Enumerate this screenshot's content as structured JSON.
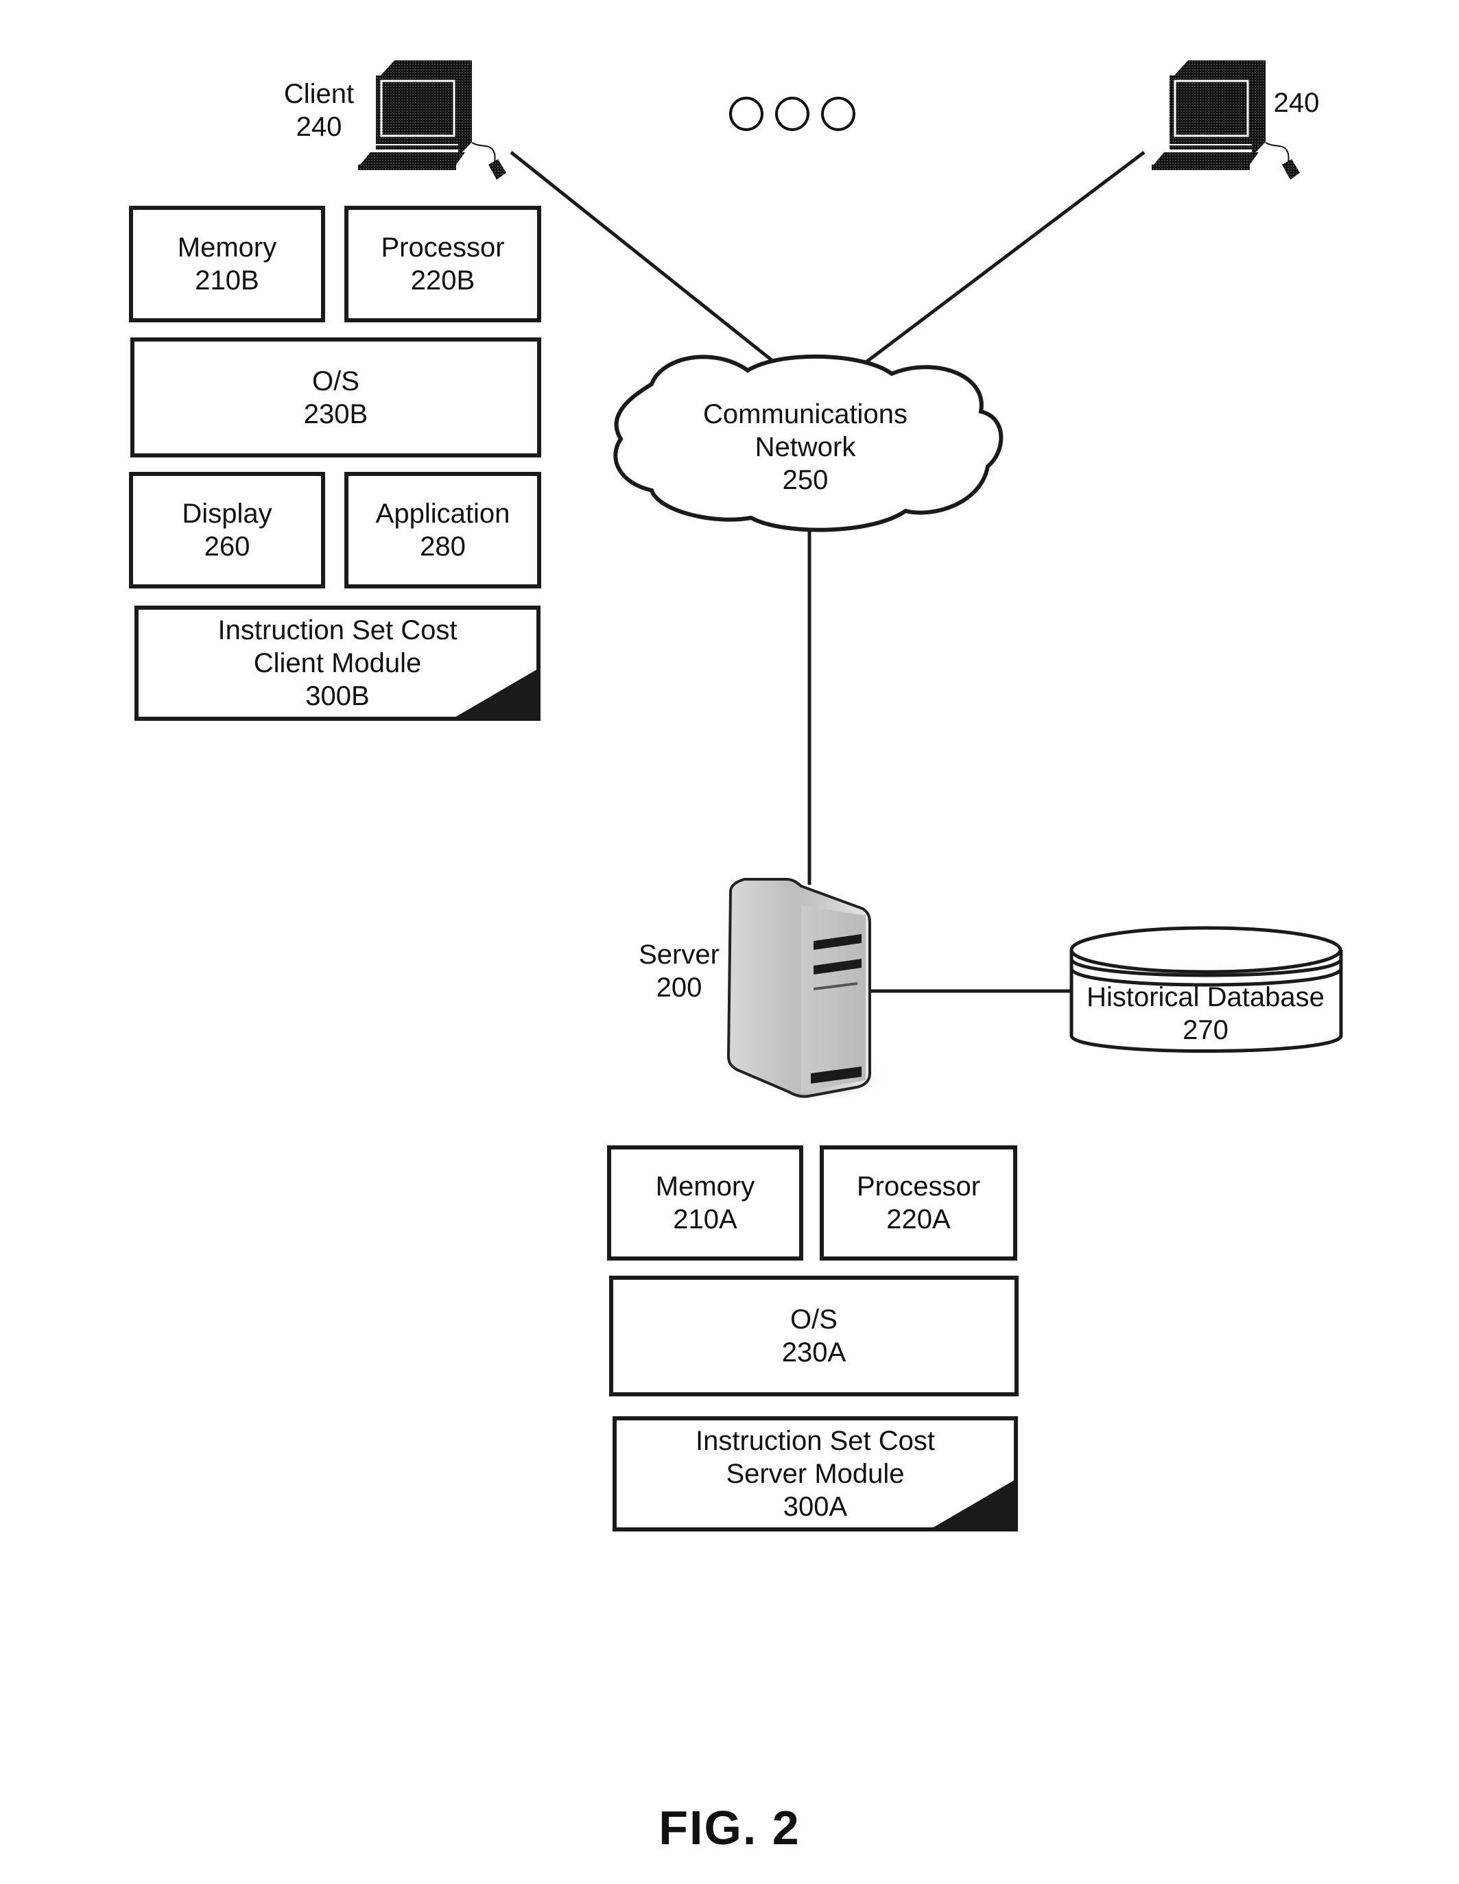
{
  "figure": {
    "caption": "FIG. 2"
  },
  "clients": [
    {
      "label": "Client",
      "ref": "240",
      "icon": "desktop-computer-icon"
    },
    {
      "label": "",
      "ref": "240",
      "icon": "desktop-computer-icon"
    }
  ],
  "ellipsis": {
    "icon": "ellipsis-circles-icon",
    "count": 3
  },
  "client_components": {
    "memory": {
      "name": "Memory",
      "ref": "210B"
    },
    "processor": {
      "name": "Processor",
      "ref": "220B"
    },
    "os": {
      "name": "O/S",
      "ref": "230B"
    },
    "display": {
      "name": "Display",
      "ref": "260"
    },
    "application": {
      "name": "Application",
      "ref": "280"
    },
    "module": {
      "line1": "Instruction Set Cost",
      "line2": "Client Module",
      "ref": "300B"
    }
  },
  "network": {
    "line1": "Communications",
    "line2": "Network",
    "ref": "250",
    "icon": "cloud-icon"
  },
  "server": {
    "label": "Server",
    "ref": "200",
    "icon": "server-tower-icon"
  },
  "database": {
    "label": "Historical Database",
    "ref": "270",
    "icon": "database-cylinder-icon"
  },
  "server_components": {
    "memory": {
      "name": "Memory",
      "ref": "210A"
    },
    "processor": {
      "name": "Processor",
      "ref": "220A"
    },
    "os": {
      "name": "O/S",
      "ref": "230A"
    },
    "module": {
      "line1": "Instruction Set Cost",
      "line2": "Server Module",
      "ref": "300A"
    }
  },
  "connections": [
    {
      "from": "client-240-left",
      "to": "communications-network-250"
    },
    {
      "from": "client-240-right",
      "to": "communications-network-250"
    },
    {
      "from": "communications-network-250",
      "to": "server-200"
    },
    {
      "from": "server-200",
      "to": "historical-database-270"
    }
  ]
}
